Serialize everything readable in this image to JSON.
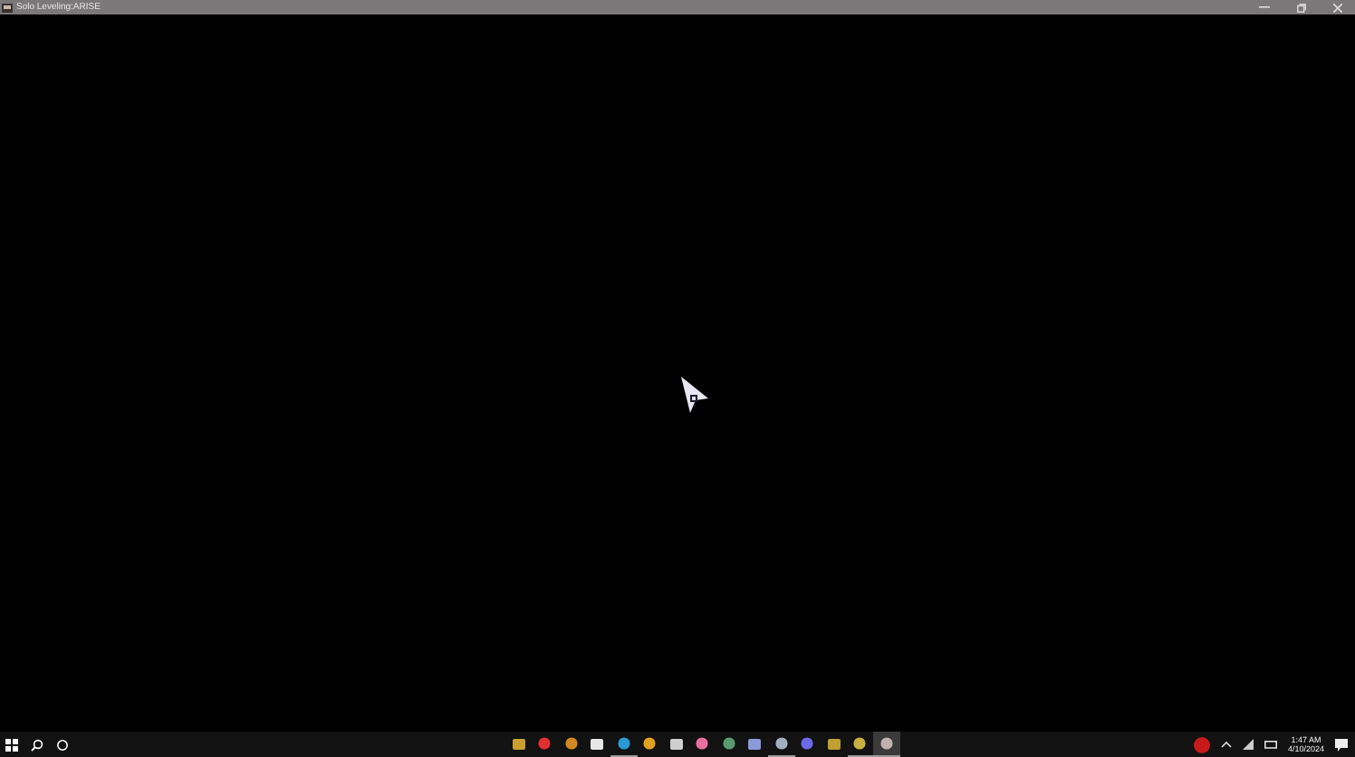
{
  "window": {
    "title": "Solo Leveling:ARISE"
  },
  "taskbar": {
    "apps": [
      {
        "running": false,
        "selected": false
      },
      {
        "running": false,
        "selected": false
      },
      {
        "running": false,
        "selected": false
      },
      {
        "running": false,
        "selected": false
      },
      {
        "running": true,
        "selected": false
      },
      {
        "running": false,
        "selected": false
      },
      {
        "running": false,
        "selected": false
      },
      {
        "running": false,
        "selected": false
      },
      {
        "running": false,
        "selected": false
      },
      {
        "running": false,
        "selected": false
      },
      {
        "running": true,
        "selected": false
      },
      {
        "running": false,
        "selected": false
      },
      {
        "running": false,
        "selected": false
      },
      {
        "running": true,
        "selected": false
      },
      {
        "running": true,
        "selected": true
      }
    ],
    "time": "1:47 AM",
    "date": "4/10/2024"
  }
}
